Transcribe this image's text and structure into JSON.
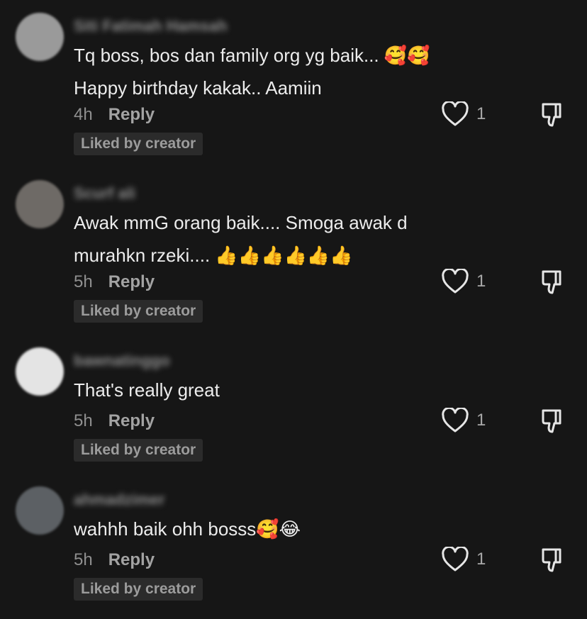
{
  "comments": [
    {
      "username": "Siti Fatimah Hamsah",
      "avatar_color": "#9a9a9a",
      "text_lines": [
        "Tq boss, bos dan family org yg baik... 🥰🥰",
        "Happy birthday kakak.. Aamiin"
      ],
      "time": "4h",
      "reply_label": "Reply",
      "like_count": "1",
      "badge": "Liked by creator"
    },
    {
      "username": "Scurf ali",
      "avatar_color": "#6e6a66",
      "text_lines": [
        "Awak mmG orang baik.... Smoga awak d",
        "murahkn rzeki.... 👍👍👍👍👍👍"
      ],
      "time": "5h",
      "reply_label": "Reply",
      "like_count": "1",
      "badge": "Liked by creator"
    },
    {
      "username": "bawnatinggo",
      "avatar_color": "#e4e4e4",
      "text_lines": [
        "That's really great"
      ],
      "time": "5h",
      "reply_label": "Reply",
      "like_count": "1",
      "badge": "Liked by creator"
    },
    {
      "username": "ahmadzimer",
      "avatar_color": "#5c6064",
      "text_lines": [
        "wahhh baik ohh bosss🥰😂"
      ],
      "time": "5h",
      "reply_label": "Reply",
      "like_count": "1",
      "badge": "Liked by creator"
    }
  ],
  "icons": {
    "like": "heart-outline-icon",
    "dislike": "thumbs-down-outline-icon"
  },
  "colors": {
    "background": "#161616",
    "text": "#ececec",
    "muted": "#8f8f8f",
    "badge_bg": "#2b2b2b"
  }
}
